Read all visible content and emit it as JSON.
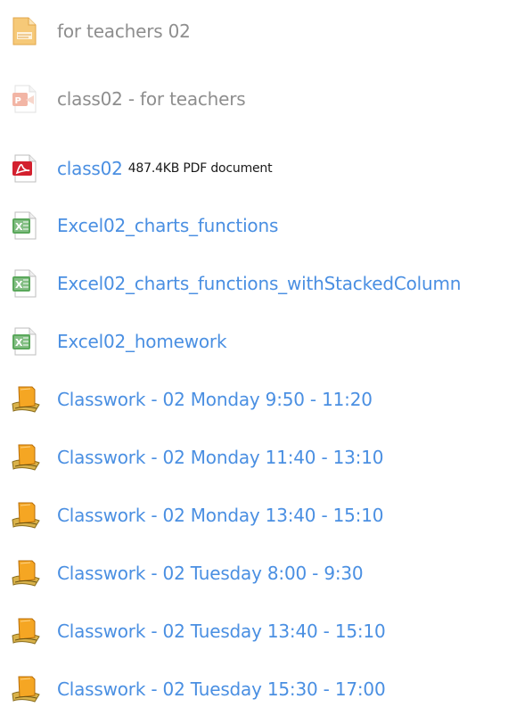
{
  "activities": [
    {
      "name": "for teachers 02",
      "icon": "text-page-icon",
      "details": ""
    },
    {
      "name": "class02 - for teachers",
      "icon": "powerpoint-file-icon",
      "details": ""
    },
    {
      "name": "class02",
      "icon": "pdf-file-icon",
      "details": "487.4KB PDF document"
    },
    {
      "name": "Excel02_charts_functions",
      "icon": "excel-file-icon",
      "details": ""
    },
    {
      "name": "Excel02_charts_functions_withStackedColumn",
      "icon": "excel-file-icon",
      "details": ""
    },
    {
      "name": "Excel02_homework",
      "icon": "excel-file-icon",
      "details": ""
    },
    {
      "name": "Classwork - 02 Monday 9:50 - 11:20",
      "icon": "assignment-icon",
      "details": ""
    },
    {
      "name": "Classwork - 02 Monday 11:40 - 13:10",
      "icon": "assignment-icon",
      "details": ""
    },
    {
      "name": "Classwork - 02 Monday 13:40 - 15:10",
      "icon": "assignment-icon",
      "details": ""
    },
    {
      "name": "Classwork - 02 Tuesday 8:00 - 9:30",
      "icon": "assignment-icon",
      "details": ""
    },
    {
      "name": "Classwork - 02 Tuesday 13:40 - 15:10",
      "icon": "assignment-icon",
      "details": ""
    },
    {
      "name": "Classwork - 02 Tuesday 15:30 - 17:00",
      "icon": "assignment-icon",
      "details": ""
    }
  ],
  "colors": {
    "link": "#4a8fe2",
    "dimmed_link": "#8e8e8e",
    "details_text": "#1a1a1a"
  }
}
